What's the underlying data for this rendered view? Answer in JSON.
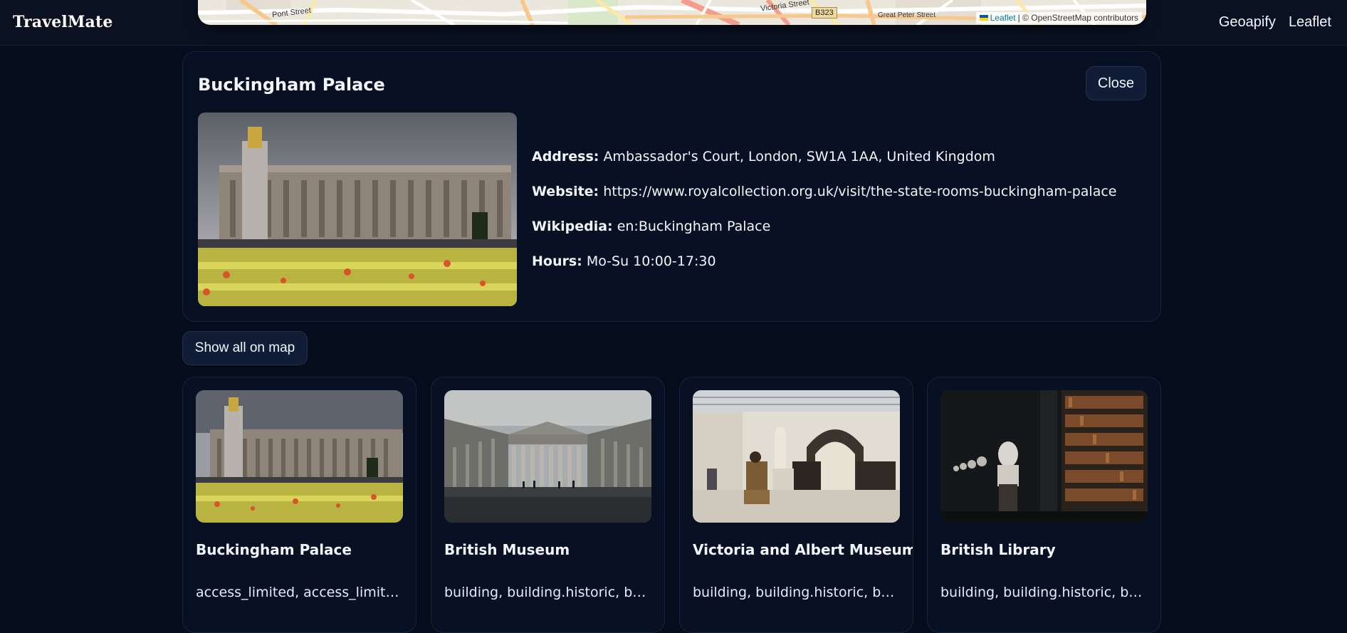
{
  "header": {
    "brand": "TravelMate",
    "nav": [
      {
        "label": "Geoapify"
      },
      {
        "label": "Leaflet"
      }
    ]
  },
  "map": {
    "streets": [
      "Pont Street",
      "Victoria Street",
      "Great Peter Street"
    ],
    "road_shield": "B323",
    "attribution": {
      "link": "Leaflet",
      "text": "| © OpenStreetMap contributors"
    }
  },
  "detail": {
    "title": "Buckingham Palace",
    "close_label": "Close",
    "image": "buckingham-palace-photo",
    "fields": [
      {
        "label": "Address:",
        "value": "Ambassador's Court, London, SW1A 1AA, United Kingdom"
      },
      {
        "label": "Website:",
        "value": "https://www.royalcollection.org.uk/visit/the-state-rooms-buckingham-palace"
      },
      {
        "label": "Wikipedia:",
        "value": "en:Buckingham Palace"
      },
      {
        "label": "Hours:",
        "value": "Mo-Su 10:00-17:30"
      }
    ]
  },
  "show_all_label": "Show all on map",
  "cards": [
    {
      "title": "Buckingham Palace",
      "categories": "access_limited, access_limited.with_fee, building",
      "image": "buckingham-palace-photo"
    },
    {
      "title": "British Museum",
      "categories": "building, building.historic, building.tourism",
      "image": "british-museum-photo"
    },
    {
      "title": "Victoria and Albert Museum",
      "categories": "building, building.historic, building.tourism",
      "image": "va-museum-photo"
    },
    {
      "title": "British Library",
      "categories": "building, building.historic, building.tourism",
      "image": "british-library-photo"
    }
  ],
  "colors": {
    "background": "#050d1c",
    "panel": "#081123",
    "button": "#111c36",
    "text": "#f2f5fb"
  }
}
